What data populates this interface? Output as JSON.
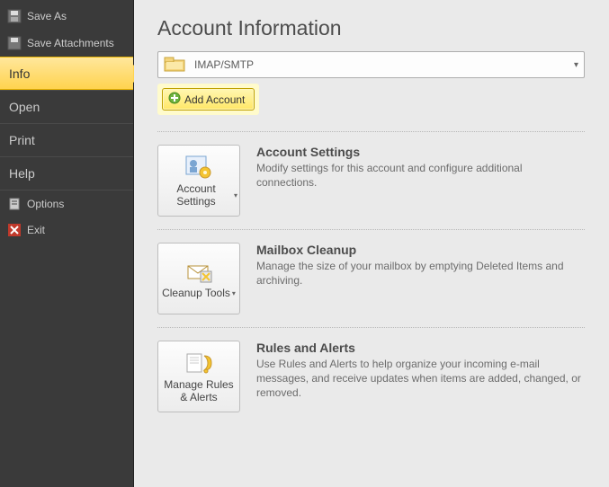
{
  "sidebar": {
    "save_as": "Save As",
    "save_attachments": "Save Attachments",
    "info": "Info",
    "open": "Open",
    "print": "Print",
    "help": "Help",
    "options": "Options",
    "exit": "Exit"
  },
  "main": {
    "title": "Account Information",
    "account_type": "IMAP/SMTP",
    "add_account": "Add Account"
  },
  "sections": {
    "account_settings": {
      "tile": "Account Settings",
      "heading": "Account Settings",
      "body": "Modify settings for this account and configure additional connections."
    },
    "cleanup": {
      "tile": "Cleanup Tools",
      "heading": "Mailbox Cleanup",
      "body": "Manage the size of your mailbox by emptying Deleted Items and archiving."
    },
    "rules": {
      "tile": "Manage Rules & Alerts",
      "heading": "Rules and Alerts",
      "body": "Use Rules and Alerts to help organize your incoming e-mail messages, and receive updates when items are added, changed, or removed."
    }
  }
}
